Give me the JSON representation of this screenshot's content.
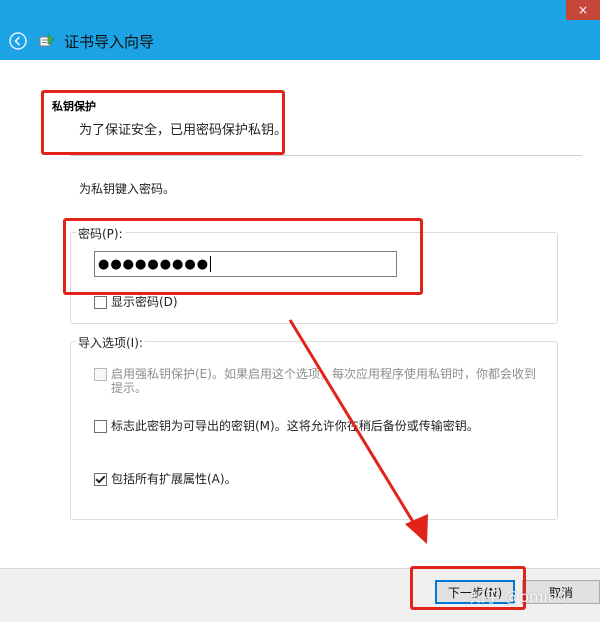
{
  "window": {
    "close_label": "×",
    "title": "证书导入向导"
  },
  "header": {
    "title": "私钥保护",
    "subtitle": "为了保证安全，已用密码保护私钥。"
  },
  "main": {
    "prompt": "为私钥键入密码。",
    "password_label": "密码(P):",
    "password_value": "●●●●●●●●●",
    "show_password_label": "显示密码(D)",
    "options_label": "导入选项(I):",
    "options": [
      {
        "label": "启用强私钥保护(E)。如果启用这个选项，每次应用程序使用私钥时，你都会收到提示。",
        "checked": false,
        "enabled": false
      },
      {
        "label": "标志此密钥为可导出的密钥(M)。这将允许你在稍后备份或传输密钥。",
        "checked": false,
        "enabled": true
      },
      {
        "label": "包括所有扩展属性(A)。",
        "checked": true,
        "enabled": true
      }
    ]
  },
  "footer": {
    "next_label": "下一步(N)",
    "cancel_label": "取消"
  },
  "watermark": "知乎 @omio0",
  "colors": {
    "titlebar": "#1ba3e6",
    "annotation_red": "#e2231a"
  },
  "icons": [
    "back-arrow-icon",
    "certificate-wizard-icon",
    "close-icon",
    "checkmark-icon"
  ]
}
